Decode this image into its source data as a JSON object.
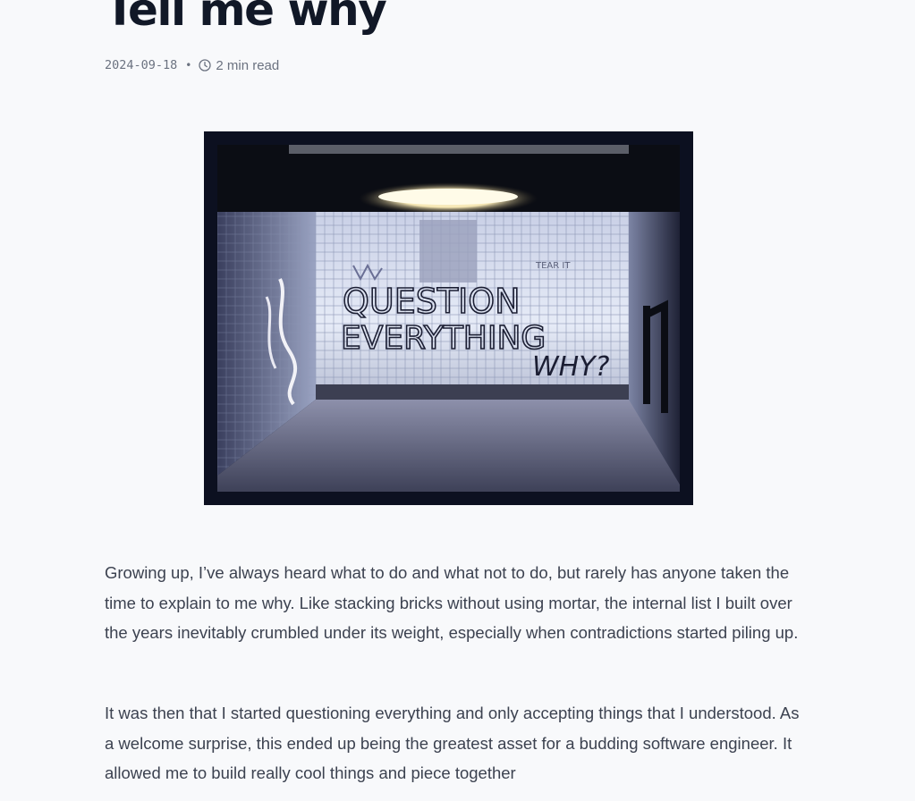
{
  "article": {
    "title": "Tell me why",
    "date": "2024-09-18",
    "separator": "•",
    "read_time": "2 min read",
    "hero_image": {
      "icon": "graffiti-photo",
      "graffiti_lines": [
        "QUESTION",
        "EVERYTHING",
        "WHY?"
      ],
      "tag_text": "TEAR IT"
    },
    "paragraphs": [
      "Growing up, I’ve always heard what to do and what not to do, but rarely has anyone taken the time to explain to me why. Like stacking bricks without using mortar, the internal list I built over the years inevitably crumbled under its weight, especially when contradictions started piling up.",
      "It was then that I started questioning everything and only accepting things that I understood. As a welcome surprise, this ended up being the greatest asset for a budding software engineer. It allowed me to build really cool things and piece together"
    ]
  }
}
